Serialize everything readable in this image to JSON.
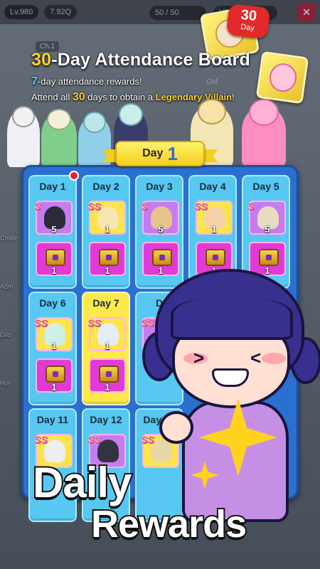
{
  "hud": {
    "level": "Lv.980",
    "currency": "7.92Q",
    "stamina": "50 / 50",
    "ypoint": "YPoint",
    "chapter": "Ch.1",
    "gm": "GM",
    "side_labels": [
      "Challe",
      "Adm",
      "Gro",
      "Hor"
    ]
  },
  "badge": {
    "number": "30",
    "unit": "Day"
  },
  "header": {
    "title_num": "30",
    "title_rest": "-Day Attendance Board",
    "sub1_num": "7",
    "sub1_rest": "-day attendance rewards!",
    "sub2_pre": "Attend all ",
    "sub2_num": "30",
    "sub2_mid": " days to obtain a ",
    "sub2_hl": "Legendary Villain",
    "sub2_end": "!"
  },
  "board": {
    "current_label": "Day",
    "current_day": "1",
    "days": [
      {
        "label": "Day 1",
        "rank": "S",
        "hero_qty": "5",
        "item_qty": "1"
      },
      {
        "label": "Day 2",
        "rank": "SS",
        "hero_qty": "1",
        "item_qty": "1"
      },
      {
        "label": "Day 3",
        "rank": "S",
        "hero_qty": "5",
        "item_qty": "1"
      },
      {
        "label": "Day 4",
        "rank": "SS",
        "hero_qty": "1",
        "item_qty": "1"
      },
      {
        "label": "Day 5",
        "rank": "S",
        "hero_qty": "5",
        "item_qty": "1"
      },
      {
        "label": "Day 6",
        "rank": "SS",
        "hero_qty": "1",
        "item_qty": "1"
      },
      {
        "label": "Day 7",
        "rank": "SS",
        "hero_qty": "1",
        "item_qty": "1"
      },
      {
        "label": "D",
        "rank": "SS",
        "hero_qty": "",
        "item_qty": ""
      },
      {
        "label": "Day 11",
        "rank": "SS",
        "hero_qty": "",
        "item_qty": ""
      },
      {
        "label": "Day 12",
        "rank": "SS",
        "hero_qty": "",
        "item_qty": ""
      },
      {
        "label": "Day 13",
        "rank": "SS",
        "hero_qty": "",
        "item_qty": ""
      }
    ]
  },
  "banner": {
    "line1": "Daily",
    "line2": "Rewards"
  },
  "colors": {
    "board_blue": "#2b6fd0",
    "cell_blue": "#56c8f2",
    "cell_today": "#ffe94a",
    "highlight_yellow": "#ffd22e",
    "highlight_cyan": "#5ad7ff"
  }
}
